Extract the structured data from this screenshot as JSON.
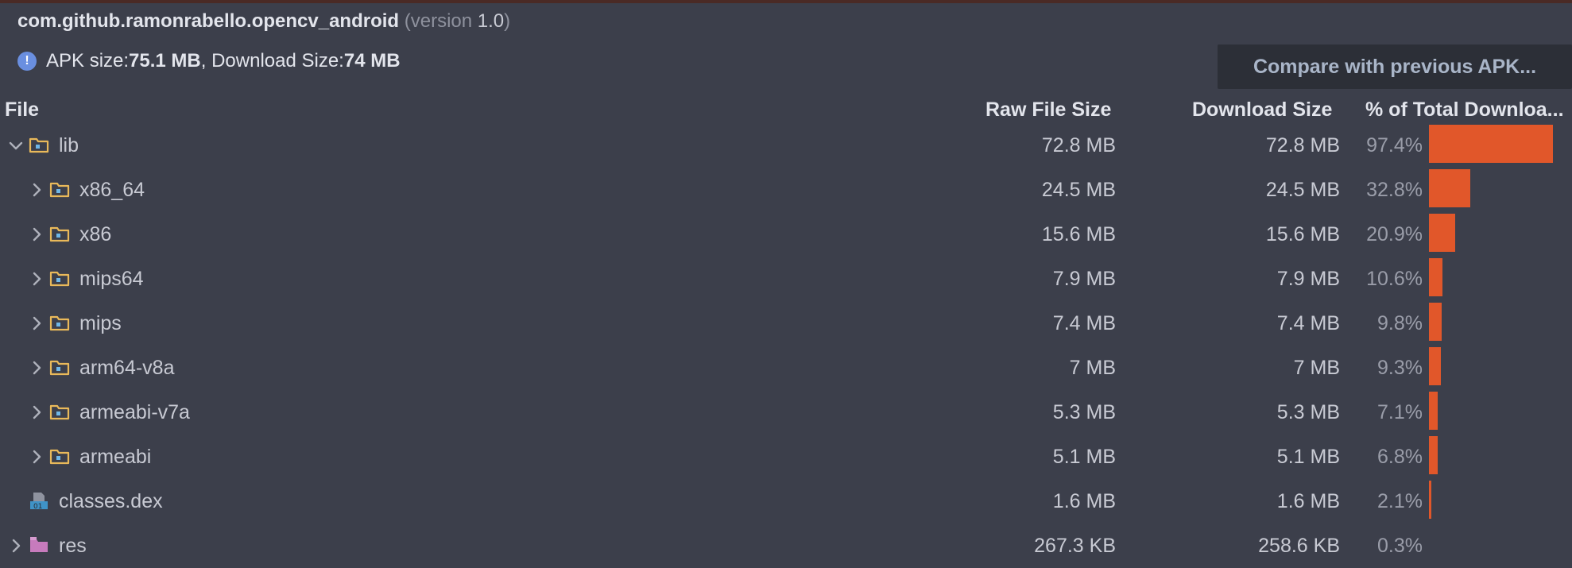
{
  "app": {
    "package": "com.github.ramonrabello.opencv_android",
    "version_open": "(version ",
    "version_number": "1.0",
    "version_close": ")"
  },
  "summary": {
    "apk_size_label": "APK size: ",
    "apk_size_value": "75.1 MB",
    "separator": ", Download Size: ",
    "download_size_value": "74 MB"
  },
  "compare_button": "Compare with previous APK...",
  "columns": {
    "file": "File",
    "raw": "Raw File Size",
    "download": "Download Size",
    "percent": "% of Total Downloa..."
  },
  "rows": [
    {
      "name": "lib",
      "raw": "72.8 MB",
      "download": "72.8 MB",
      "percent": "97.4%",
      "share": 0.974,
      "icon": "folder-icon",
      "expanded": true,
      "depth": 0
    },
    {
      "name": "x86_64",
      "raw": "24.5 MB",
      "download": "24.5 MB",
      "percent": "32.8%",
      "share": 0.328,
      "icon": "folder-icon",
      "expanded": false,
      "depth": 1
    },
    {
      "name": "x86",
      "raw": "15.6 MB",
      "download": "15.6 MB",
      "percent": "20.9%",
      "share": 0.209,
      "icon": "folder-icon",
      "expanded": false,
      "depth": 1
    },
    {
      "name": "mips64",
      "raw": "7.9 MB",
      "download": "7.9 MB",
      "percent": "10.6%",
      "share": 0.106,
      "icon": "folder-icon",
      "expanded": false,
      "depth": 1
    },
    {
      "name": "mips",
      "raw": "7.4 MB",
      "download": "7.4 MB",
      "percent": "9.8%",
      "share": 0.098,
      "icon": "folder-icon",
      "expanded": false,
      "depth": 1
    },
    {
      "name": "arm64-v8a",
      "raw": "7 MB",
      "download": "7 MB",
      "percent": "9.3%",
      "share": 0.093,
      "icon": "folder-icon",
      "expanded": false,
      "depth": 1
    },
    {
      "name": "armeabi-v7a",
      "raw": "5.3 MB",
      "download": "5.3 MB",
      "percent": "7.1%",
      "share": 0.071,
      "icon": "folder-icon",
      "expanded": false,
      "depth": 1
    },
    {
      "name": "armeabi",
      "raw": "5.1 MB",
      "download": "5.1 MB",
      "percent": "6.8%",
      "share": 0.068,
      "icon": "folder-icon",
      "expanded": false,
      "depth": 1
    },
    {
      "name": "classes.dex",
      "raw": "1.6 MB",
      "download": "1.6 MB",
      "percent": "2.1%",
      "share": 0.021,
      "icon": "dex-file-icon",
      "expanded": null,
      "depth": 0
    },
    {
      "name": "res",
      "raw": "267.3 KB",
      "download": "258.6 KB",
      "percent": "0.3%",
      "share": 0.003,
      "icon": "res-folder-icon",
      "expanded": false,
      "depth": 0
    }
  ],
  "colors": {
    "background": "#3c3f4b",
    "bar": "#e1572a",
    "info_icon": "#6a8fe0",
    "folder_outline": "#e9b95a",
    "res_folder": "#c77bbd"
  }
}
